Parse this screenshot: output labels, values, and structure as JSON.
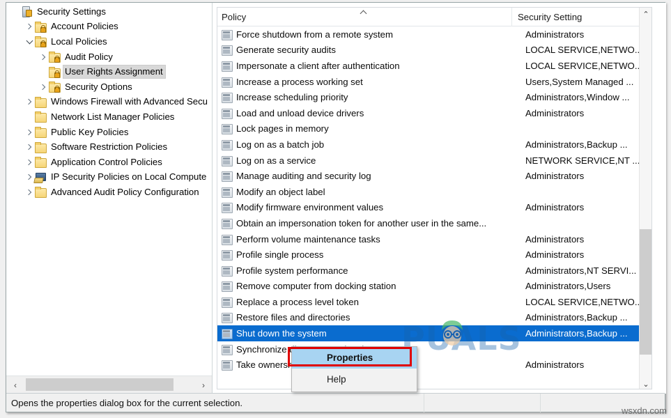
{
  "tree": {
    "items": [
      {
        "label": "Security Settings",
        "depth": 0,
        "chevron": "none",
        "icon": "security-root-icon",
        "selected": false
      },
      {
        "label": "Account Policies",
        "depth": 1,
        "chevron": "collapsed",
        "icon": "locked-folder-icon",
        "selected": false
      },
      {
        "label": "Local Policies",
        "depth": 1,
        "chevron": "expanded",
        "icon": "locked-folder-icon",
        "selected": false
      },
      {
        "label": "Audit Policy",
        "depth": 2,
        "chevron": "collapsed",
        "icon": "locked-folder-icon",
        "selected": false
      },
      {
        "label": "User Rights Assignment",
        "depth": 2,
        "chevron": "none",
        "icon": "locked-folder-icon",
        "selected": true
      },
      {
        "label": "Security Options",
        "depth": 2,
        "chevron": "collapsed",
        "icon": "locked-folder-icon",
        "selected": false
      },
      {
        "label": "Windows Firewall with Advanced Secu",
        "depth": 1,
        "chevron": "collapsed",
        "icon": "folder-icon",
        "selected": false
      },
      {
        "label": "Network List Manager Policies",
        "depth": 1,
        "chevron": "none",
        "icon": "folder-icon",
        "selected": false
      },
      {
        "label": "Public Key Policies",
        "depth": 1,
        "chevron": "collapsed",
        "icon": "folder-icon",
        "selected": false
      },
      {
        "label": "Software Restriction Policies",
        "depth": 1,
        "chevron": "collapsed",
        "icon": "folder-icon",
        "selected": false
      },
      {
        "label": "Application Control Policies",
        "depth": 1,
        "chevron": "collapsed",
        "icon": "folder-icon",
        "selected": false
      },
      {
        "label": "IP Security Policies on Local Compute",
        "depth": 1,
        "chevron": "collapsed",
        "icon": "ipsec-icon",
        "selected": false
      },
      {
        "label": "Advanced Audit Policy Configuration",
        "depth": 1,
        "chevron": "collapsed",
        "icon": "folder-icon",
        "selected": false
      }
    ],
    "hscroll": {
      "left_arrow": "‹",
      "right_arrow": "›"
    }
  },
  "list": {
    "columns": {
      "policy": "Policy",
      "setting": "Security Setting"
    },
    "sort": "ascending",
    "rows": [
      {
        "policy": "Force shutdown from a remote system",
        "setting": "Administrators",
        "selected": false
      },
      {
        "policy": "Generate security audits",
        "setting": "LOCAL SERVICE,NETWO...",
        "selected": false
      },
      {
        "policy": "Impersonate a client after authentication",
        "setting": "LOCAL SERVICE,NETWO...",
        "selected": false
      },
      {
        "policy": "Increase a process working set",
        "setting": "Users,System Managed ...",
        "selected": false
      },
      {
        "policy": "Increase scheduling priority",
        "setting": "Administrators,Window ...",
        "selected": false
      },
      {
        "policy": "Load and unload device drivers",
        "setting": "Administrators",
        "selected": false
      },
      {
        "policy": "Lock pages in memory",
        "setting": "",
        "selected": false
      },
      {
        "policy": "Log on as a batch job",
        "setting": "Administrators,Backup ...",
        "selected": false
      },
      {
        "policy": "Log on as a service",
        "setting": "NETWORK SERVICE,NT ...",
        "selected": false
      },
      {
        "policy": "Manage auditing and security log",
        "setting": "Administrators",
        "selected": false
      },
      {
        "policy": "Modify an object label",
        "setting": "",
        "selected": false
      },
      {
        "policy": "Modify firmware environment values",
        "setting": "Administrators",
        "selected": false
      },
      {
        "policy": "Obtain an impersonation token for another user in the same...",
        "setting": "",
        "selected": false
      },
      {
        "policy": "Perform volume maintenance tasks",
        "setting": "Administrators",
        "selected": false
      },
      {
        "policy": "Profile single process",
        "setting": "Administrators",
        "selected": false
      },
      {
        "policy": "Profile system performance",
        "setting": "Administrators,NT SERVI...",
        "selected": false
      },
      {
        "policy": "Remove computer from docking station",
        "setting": "Administrators,Users",
        "selected": false
      },
      {
        "policy": "Replace a process level token",
        "setting": "LOCAL SERVICE,NETWO...",
        "selected": false
      },
      {
        "policy": "Restore files and directories",
        "setting": "Administrators,Backup ...",
        "selected": false
      },
      {
        "policy": "Shut down the system",
        "setting": "Administrators,Backup ...",
        "selected": true
      },
      {
        "policy": "Synchronize directory service data",
        "setting": "",
        "selected": false
      },
      {
        "policy": "Take ownership of files or other objects",
        "setting": "Administrators",
        "selected": false
      }
    ],
    "vscroll": {
      "up_arrow": "⌃",
      "down_arrow": "⌄"
    }
  },
  "context_menu": {
    "items": [
      {
        "label": "Properties",
        "highlighted": true
      },
      {
        "label": "Help",
        "highlighted": false
      }
    ]
  },
  "statusbar": {
    "text": "Opens the properties dialog box for the current selection."
  },
  "watermarks": {
    "brand": "PUALS",
    "site": "wsxdn.com"
  },
  "colors": {
    "selection": "#0a6ccf",
    "menu_highlight": "#a8d4f2",
    "annotation": "#e00000"
  }
}
